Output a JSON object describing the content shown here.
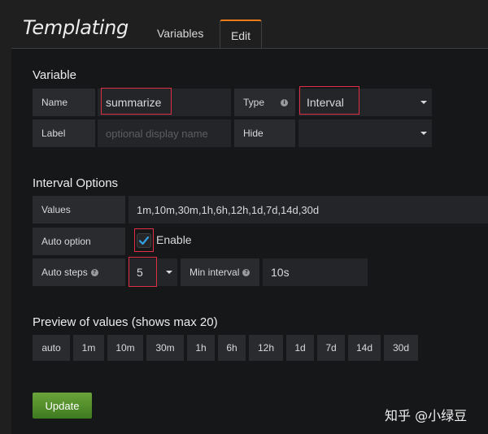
{
  "header": {
    "title": "Templating",
    "tabs": [
      {
        "label": "Variables"
      },
      {
        "label": "Edit"
      }
    ]
  },
  "variable": {
    "section_title": "Variable",
    "name_label": "Name",
    "name_value": "summarize",
    "type_label": "Type",
    "type_value": "Interval",
    "label_label": "Label",
    "label_placeholder": "optional display name",
    "hide_label": "Hide",
    "hide_value": ""
  },
  "interval_options": {
    "section_title": "Interval Options",
    "values_label": "Values",
    "values_value": "1m,10m,30m,1h,6h,12h,1d,7d,14d,30d",
    "auto_option_label": "Auto option",
    "auto_enable_label": "Enable",
    "auto_enabled": true,
    "auto_steps_label": "Auto steps",
    "auto_steps_value": "5",
    "min_interval_label": "Min interval",
    "min_interval_value": "10s"
  },
  "preview": {
    "section_title": "Preview of values (shows max 20)",
    "values": [
      "auto",
      "1m",
      "10m",
      "30m",
      "1h",
      "6h",
      "12h",
      "1d",
      "7d",
      "14d",
      "30d"
    ]
  },
  "update_label": "Update",
  "watermark": "知乎 @小绿豆",
  "colors": {
    "accent_orange": "#eb7b18",
    "highlight_red": "#e02f44",
    "checkbox_blue": "#33a2e5",
    "update_green": "#4d8b2e"
  }
}
